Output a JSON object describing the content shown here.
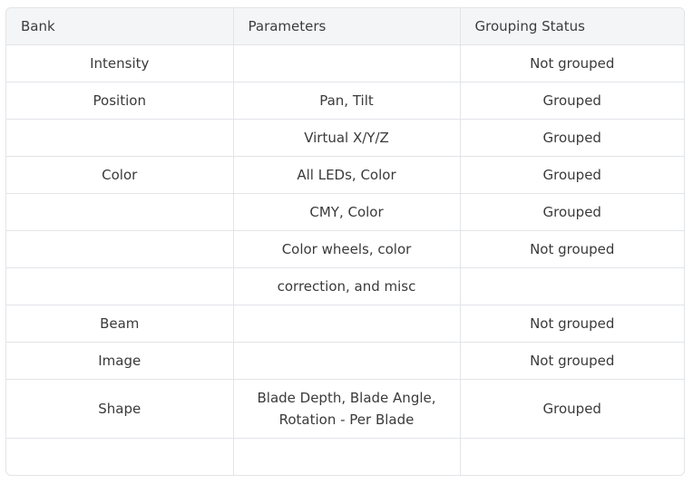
{
  "table": {
    "headers": [
      "Bank",
      "Parameters",
      "Grouping Status"
    ],
    "rows": [
      {
        "bank": "Intensity",
        "parameters": [
          ""
        ],
        "status": "Not grouped"
      },
      {
        "bank": "Position",
        "parameters": [
          "Pan, Tilt"
        ],
        "status": "Grouped"
      },
      {
        "bank": "",
        "parameters": [
          "Virtual X/Y/Z"
        ],
        "status": "Grouped"
      },
      {
        "bank": "Color",
        "parameters": [
          "All LEDs, Color"
        ],
        "status": "Grouped"
      },
      {
        "bank": "",
        "parameters": [
          "CMY, Color"
        ],
        "status": "Grouped"
      },
      {
        "bank": "",
        "parameters": [
          "Color wheels, color"
        ],
        "status": "Not grouped"
      },
      {
        "bank": "",
        "parameters": [
          "correction, and misc"
        ],
        "status": ""
      },
      {
        "bank": "Beam",
        "parameters": [
          ""
        ],
        "status": "Not grouped"
      },
      {
        "bank": "Image",
        "parameters": [
          ""
        ],
        "status": "Not grouped"
      },
      {
        "bank": "Shape",
        "parameters": [
          "Blade Depth, Blade Angle,",
          "Rotation - Per Blade"
        ],
        "status": "Grouped"
      },
      {
        "bank": "",
        "parameters": [
          ""
        ],
        "status": ""
      }
    ]
  }
}
